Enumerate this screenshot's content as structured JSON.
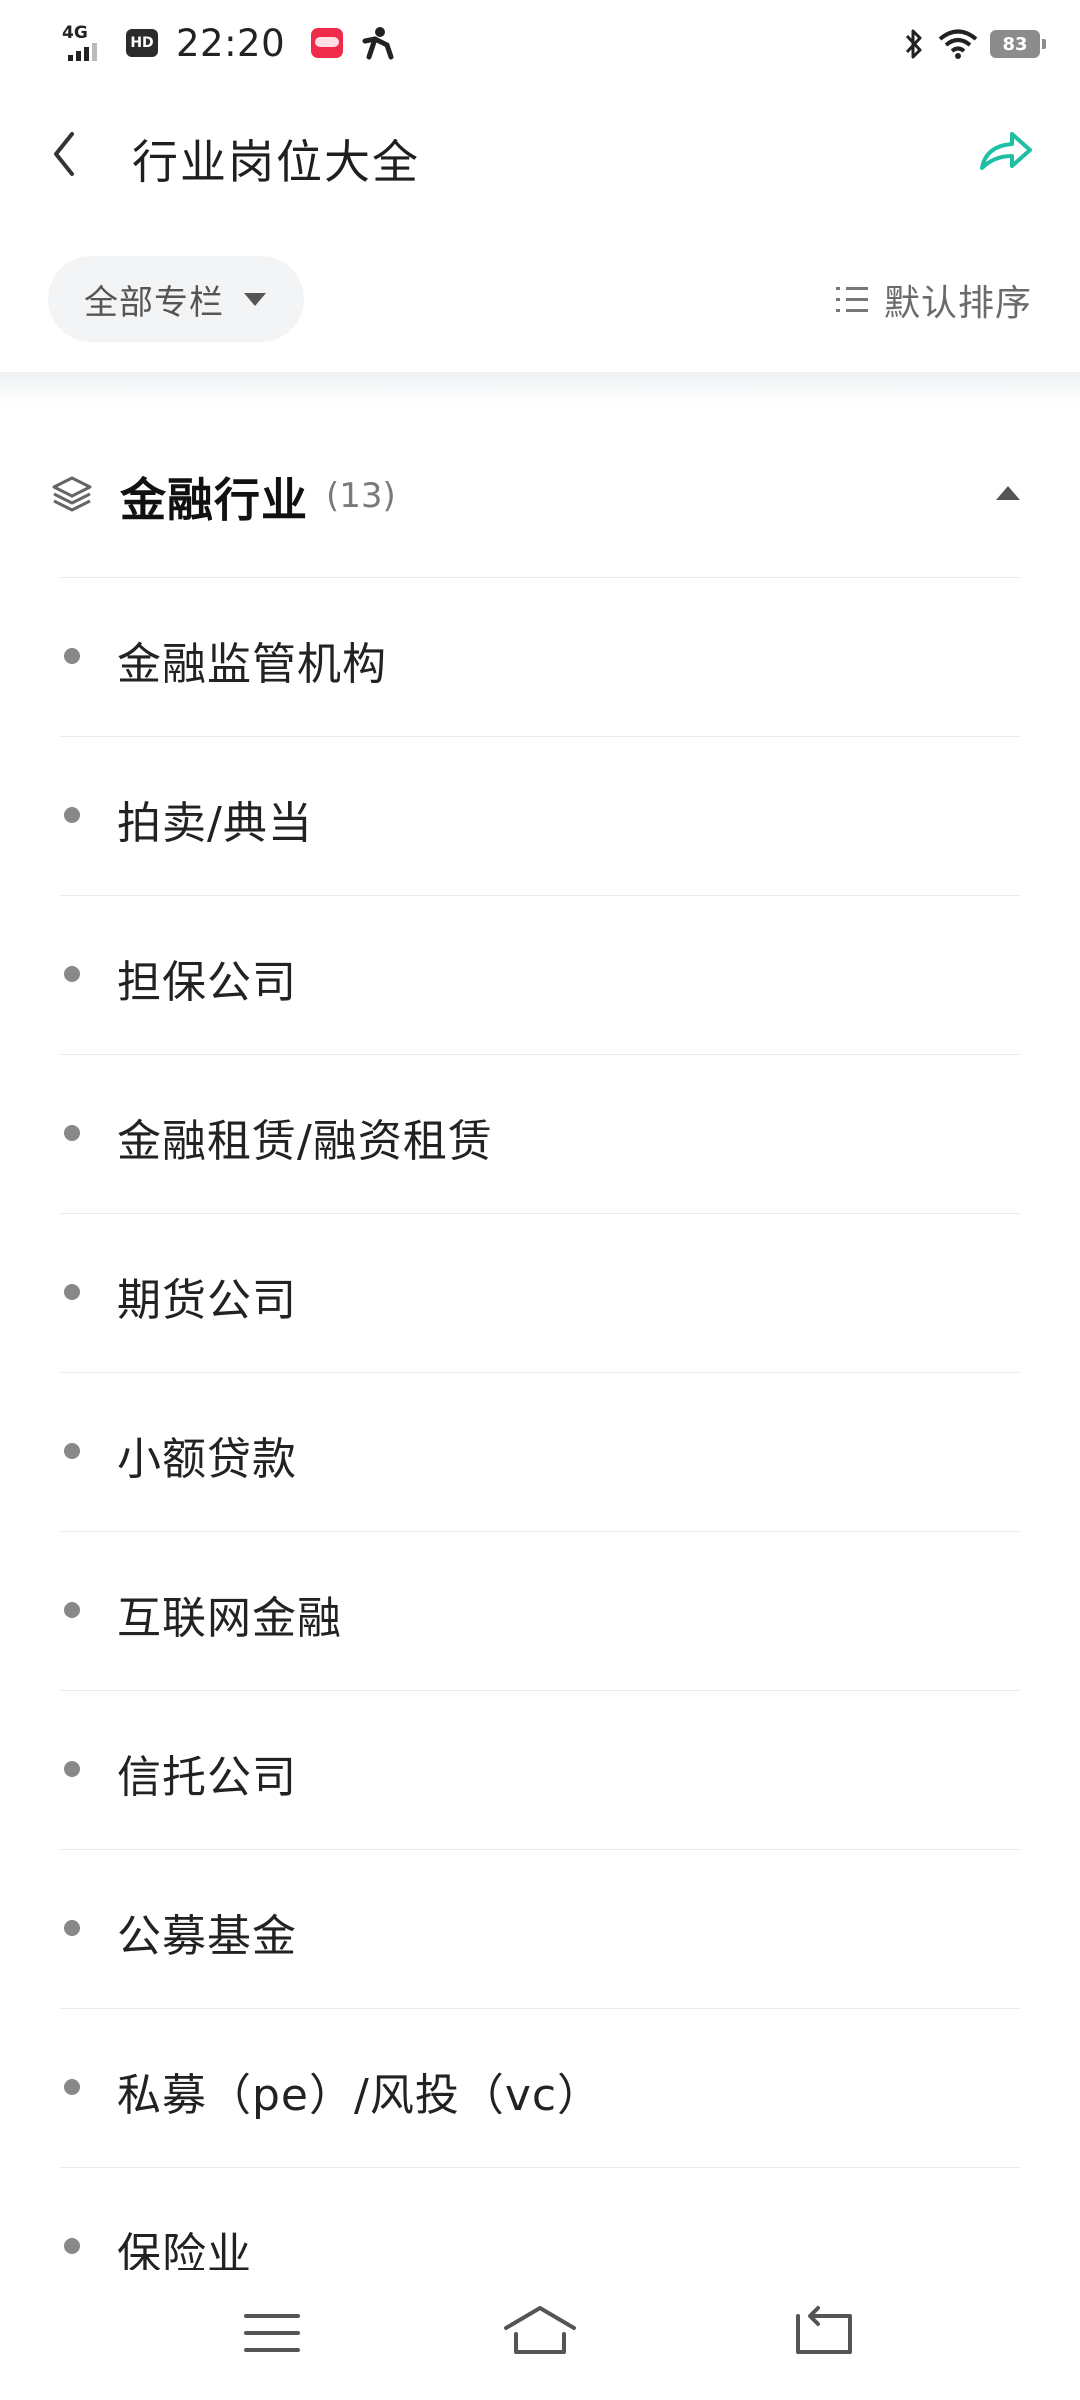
{
  "status_bar": {
    "network": "4G",
    "hd": "HD",
    "time": "22:20",
    "battery": "83"
  },
  "header": {
    "title": "行业岗位大全"
  },
  "filter": {
    "dropdown_label": "全部专栏",
    "sort_label": "默认排序"
  },
  "section": {
    "title": "金融行业",
    "count": "(13)",
    "items": [
      "金融监管机构",
      "拍卖/典当",
      "担保公司",
      "金融租赁/融资租赁",
      "期货公司",
      "小额贷款",
      "互联网金融",
      "信托公司",
      "公募基金",
      "私募（pe）/风投（vc）",
      "保险业"
    ]
  },
  "colors": {
    "accent": "#1fbfa6",
    "text": "#222222",
    "muted": "#7a7a7a"
  }
}
